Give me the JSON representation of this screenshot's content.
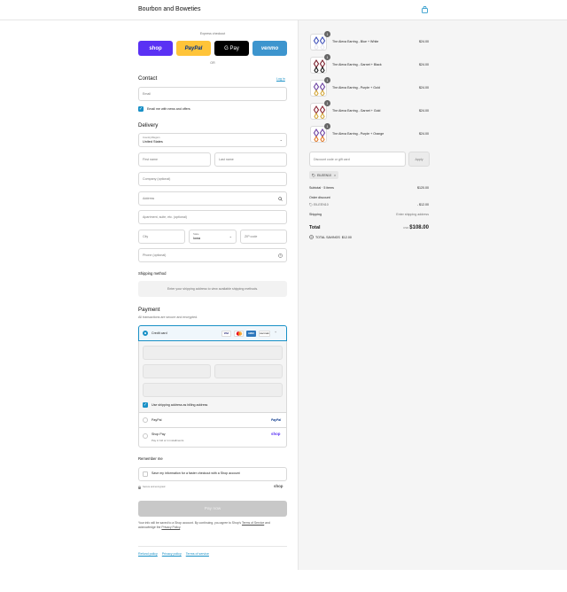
{
  "header": {
    "shop_name": "Bourbon and Boweties",
    "cart_icon": "shopping-bag-icon"
  },
  "express": {
    "title": "Express checkout",
    "buttons": [
      {
        "label": "shop",
        "color": "#5a31f4",
        "text_color": "#ffffff"
      },
      {
        "label": "PayPal",
        "color": "#ffc439",
        "text_color": "#003087"
      },
      {
        "label": "G Pay",
        "color": "#000000",
        "text_color": "#ffffff"
      },
      {
        "label": "venmo",
        "color": "#3d95ce",
        "text_color": "#ffffff"
      }
    ],
    "or": "OR"
  },
  "contact": {
    "title": "Contact",
    "login": "Log in",
    "email_placeholder": "Email",
    "news_label": "Email me with news and offers"
  },
  "delivery": {
    "title": "Delivery",
    "country_label": "Country/Region",
    "country_value": "United States",
    "first_name": "First name",
    "last_name": "Last name",
    "company": "Company (optional)",
    "address": "Address",
    "apartment": "Apartment, suite, etc. (optional)",
    "city": "City",
    "state_label": "State",
    "state_value": "Iowa",
    "zip": "ZIP code",
    "phone": "Phone (optional)"
  },
  "shipping": {
    "title": "Shipping method",
    "notice": "Enter your shipping address to view available shipping methods."
  },
  "payment": {
    "title": "Payment",
    "subtitle": "All transactions are secure and encrypted.",
    "credit_card": "Credit card",
    "card_logos": [
      "VISA",
      "MC",
      "AMEX",
      "DISCOVER"
    ],
    "more": "+",
    "billing_label": "Use shipping address as billing address",
    "paypal": "PayPal",
    "paypal_logo": "PayPal",
    "shop_pay": "Shop Pay",
    "shop_pay_sub": "Pay in full or in installments",
    "shop_pay_logo": "shop"
  },
  "remember": {
    "title": "Remember me",
    "save_label": "Save my information for a faster checkout with a Shop account",
    "secure": "Secure and encrypted",
    "shop_logo": "shop"
  },
  "pay_button": "Pay now",
  "legal": {
    "text_before": "Your info will be saved to a Shop account. By continuing, you agree to Shop's",
    "terms": "Terms of Service",
    "mid": "and acknowledge the",
    "privacy": "Privacy Policy",
    "end": "."
  },
  "footer_links": [
    "Refund policy",
    "Privacy policy",
    "Terms of service"
  ],
  "cart": {
    "items": [
      {
        "name": "The Alexa Earring - Blue + White",
        "price": "$24.00",
        "qty": "1",
        "colors": [
          "#3b4db8",
          "#e8e8f0"
        ]
      },
      {
        "name": "The Alexa Earring - Garnet + Black",
        "price": "$24.00",
        "qty": "1",
        "colors": [
          "#7a1f2b",
          "#1a1a1a"
        ]
      },
      {
        "name": "The Alexa Earring - Purple + Gold",
        "price": "$24.00",
        "qty": "1",
        "colors": [
          "#6a3fa0",
          "#d4a83a"
        ]
      },
      {
        "name": "The Alexa Earring - Garnet + Gold",
        "price": "$24.00",
        "qty": "1",
        "colors": [
          "#8a2232",
          "#d4a83a"
        ]
      },
      {
        "name": "The Alexa Earring - Purple + Orange",
        "price": "$24.00",
        "qty": "1",
        "colors": [
          "#6a3fa0",
          "#e07a2a"
        ]
      }
    ],
    "discount_placeholder": "Discount code or gift card",
    "apply": "Apply",
    "tag": "EILEEN10",
    "subtotal_label": "Subtotal · 5 items",
    "subtotal": "$120.00",
    "order_discount_label": "Order discount",
    "code": "EILEEN10",
    "discount": "- $12.00",
    "shipping_label": "Shipping",
    "shipping_value": "Enter shipping address",
    "total_label": "Total",
    "currency": "USD",
    "total": "$108.00",
    "savings_label": "TOTAL SAVINGS",
    "savings": "$12.00"
  }
}
